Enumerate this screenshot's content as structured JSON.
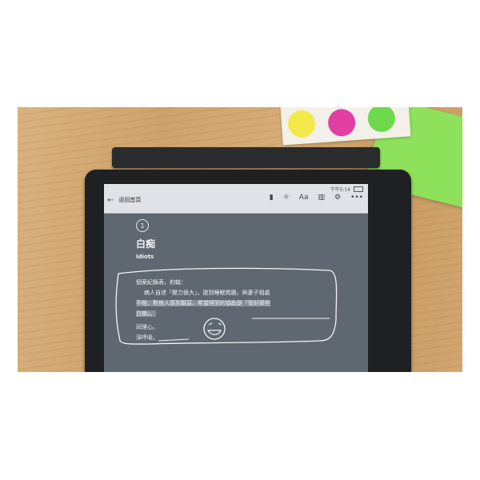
{
  "toolbar": {
    "status_time": "下午5:14",
    "back_label": "返回首頁",
    "icons": [
      "bookmark-icon",
      "brightness-icon",
      "font-icon",
      "chart-icon",
      "settings-icon",
      "more-icon"
    ],
    "font_label": "Aa",
    "more_label": "•••"
  },
  "chapter": {
    "number": "1",
    "title": "白痴",
    "subtitle": "Idiots"
  },
  "body": {
    "line1": "個案紀錄表，約翰：",
    "line2": "病人自述「壓力很大」，提到睡眠問題，與妻子相處",
    "line3a": "不睦，",
    "line3b": "對他人感到厭惡，希望得到的協助是「管好那些",
    "line4": "白痴」。",
    "line5": "同理心。",
    "line6": "深呼吸。"
  },
  "colors": {
    "screen": "#5f6770",
    "toolbar": "#dfe2e6",
    "ink": "#f4f6f8",
    "sticker_yellow": "#f3e94a",
    "sticker_magenta": "#e23fa3",
    "sticker_green": "#6fd94d",
    "paper_green": "#8ee15a"
  }
}
